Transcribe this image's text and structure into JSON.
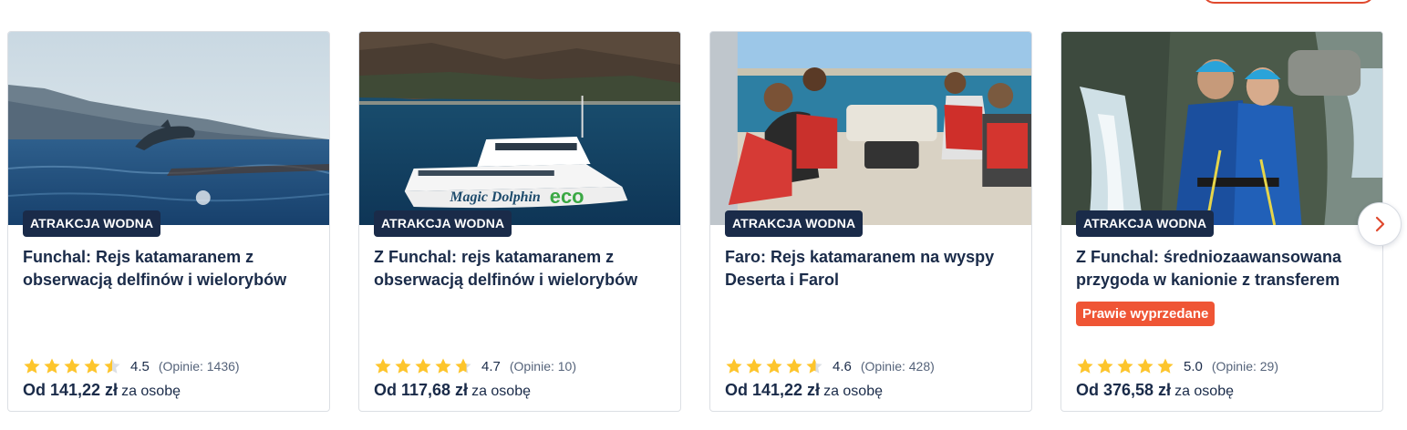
{
  "cards": [
    {
      "badge": "ATRAKCJA WODNA",
      "title": "Funchal: Rejs katamaranem z obserwacją delfinów i wielorybów",
      "flag": "",
      "rating": 4.5,
      "rating_text": "4.5",
      "reviews": "(Opinie: 1436)",
      "price": "Od 141,22 zł",
      "price_suffix": "za osobę",
      "image_icon": "dolphin-photo-icon"
    },
    {
      "badge": "ATRAKCJA WODNA",
      "title": "Z Funchal: rejs katamaranem z obserwacją delfinów i wielorybów",
      "flag": "",
      "rating": 4.7,
      "rating_text": "4.7",
      "reviews": "(Opinie: 10)",
      "price": "Od 117,68 zł",
      "price_suffix": "za osobę",
      "image_icon": "catamaran-photo-icon",
      "image_text": "Magic Dolphin",
      "image_text_eco": "eco"
    },
    {
      "badge": "ATRAKCJA WODNA",
      "title": "Faro: Rejs katamaranem na wyspy Deserta i Farol",
      "flag": "",
      "rating": 4.6,
      "rating_text": "4.6",
      "reviews": "(Opinie: 428)",
      "price": "Od 141,22 zł",
      "price_suffix": "za osobę",
      "image_icon": "boat-passengers-photo-icon"
    },
    {
      "badge": "ATRAKCJA WODNA",
      "title": "Z Funchal: średniozaawansowana przygoda w kanionie z transferem",
      "flag": "Prawie wyprzedane",
      "rating": 5.0,
      "rating_text": "5.0",
      "reviews": "(Opinie: 29)",
      "price": "Od 376,58 zł",
      "price_suffix": "za osobę",
      "image_icon": "canyoning-photo-icon"
    }
  ],
  "colors": {
    "navy": "#1a2b49",
    "star": "#fdc52c",
    "flag": "#ef5535",
    "accent": "#e0492e"
  },
  "next_button_icon": "chevron-right-icon"
}
